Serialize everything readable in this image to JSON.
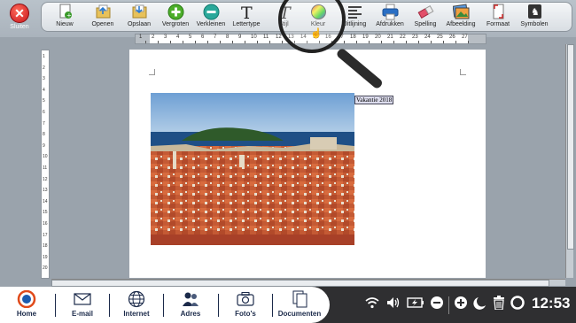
{
  "close": {
    "label": "Sluiten"
  },
  "toolbar": {
    "tools": [
      {
        "label": "Nieuw"
      },
      {
        "label": "Openen"
      },
      {
        "label": "Opslaan"
      },
      {
        "label": "Vergroten"
      },
      {
        "label": "Verkleinen"
      },
      {
        "label": "Lettertype"
      },
      {
        "label": "Stijl"
      },
      {
        "label": "Kleur"
      },
      {
        "label": "Uitlijning"
      },
      {
        "label": "Afdrukken"
      },
      {
        "label": "Spelling"
      },
      {
        "label": "Afbeelding"
      },
      {
        "label": "Formaat"
      },
      {
        "label": "Symbolen"
      }
    ]
  },
  "ruler": {
    "numbers": [
      "1",
      "2",
      "3",
      "4",
      "5",
      "6",
      "7",
      "8",
      "9",
      "10",
      "11",
      "12",
      "13",
      "14",
      "15",
      "16",
      "17",
      "18",
      "19",
      "20",
      "21",
      "22",
      "23",
      "24",
      "25",
      "26",
      "27"
    ]
  },
  "vruler": {
    "numbers": [
      "1",
      "2",
      "3",
      "4",
      "5",
      "6",
      "7",
      "8",
      "9",
      "10",
      "11",
      "12",
      "13",
      "14",
      "15",
      "16",
      "17",
      "18",
      "19",
      "20"
    ]
  },
  "document": {
    "caption": "Vakantie 2018"
  },
  "taskbar": {
    "apps": [
      {
        "label": "Home"
      },
      {
        "label": "E-mail"
      },
      {
        "label": "Internet"
      },
      {
        "label": "Adres"
      },
      {
        "label": "Foto's"
      },
      {
        "label": "Documenten"
      }
    ],
    "clock": "12:53"
  },
  "colors": {
    "taskbar_bg": "#2f2f31",
    "app_label": "#1b2a4a",
    "close_red": "#c8161d"
  }
}
